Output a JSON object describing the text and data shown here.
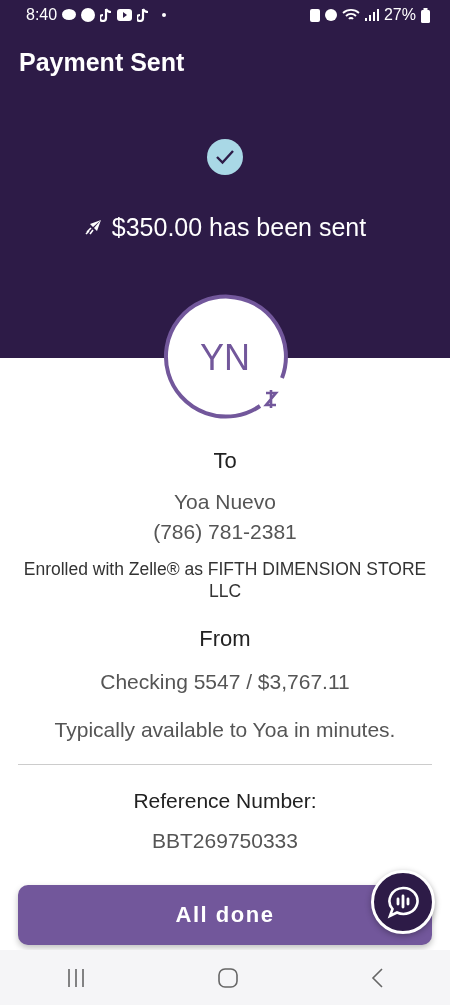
{
  "status_bar": {
    "time": "8:40",
    "battery": "27%"
  },
  "header": {
    "title": "Payment Sent",
    "message": "$350.00 has been sent"
  },
  "recipient": {
    "initials": "YN",
    "to_label": "To",
    "name": "Yoa Nuevo",
    "phone": "(786) 781-2381",
    "enrolled": "Enrolled with Zelle® as FIFTH DIMENSION STORE LLC"
  },
  "from": {
    "label": "From",
    "account": "Checking 5547 / $3,767.11",
    "availability": "Typically available to Yoa in minutes."
  },
  "reference": {
    "label": "Reference Number:",
    "number": "BBT269750333"
  },
  "button": {
    "label": "All done"
  }
}
